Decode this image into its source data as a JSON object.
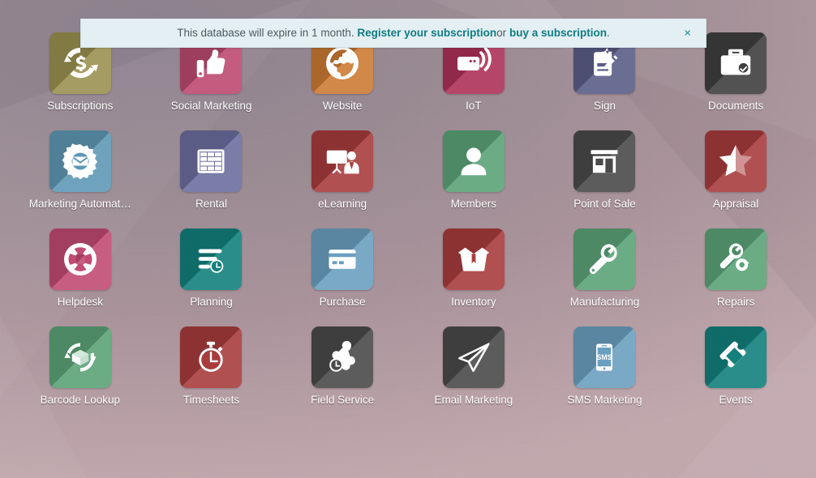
{
  "banner": {
    "text_before": "This database will expire in 1 month.",
    "link_register": "Register your subscription",
    "conjunction": "or",
    "link_buy": "buy a subscription",
    "period": ".",
    "close_label": "×",
    "background_color": "#e3eff3",
    "link_color": "#0f7c82"
  },
  "desktop": {
    "background_color": "#a8939a"
  },
  "apps": [
    {
      "label": "Subscriptions",
      "icon": "subscriptions-icon",
      "color": "#9a9150"
    },
    {
      "label": "Social Marketing",
      "icon": "social-marketing-icon",
      "color": "#bc4a70"
    },
    {
      "label": "Website",
      "icon": "website-icon",
      "color": "#cc7a33"
    },
    {
      "label": "IoT",
      "icon": "iot-icon",
      "color": "#ad3159"
    },
    {
      "label": "Sign",
      "icon": "sign-icon",
      "color": "#5a5e87"
    },
    {
      "label": "Documents",
      "icon": "documents-icon",
      "color": "#3f3f3f"
    },
    {
      "label": "Marketing Automat…",
      "icon": "marketing-automation-icon",
      "color": "#5f98b4"
    },
    {
      "label": "Rental",
      "icon": "rental-icon",
      "color": "#6b6e9e"
    },
    {
      "label": "eLearning",
      "icon": "elearning-icon",
      "color": "#a83c3c"
    },
    {
      "label": "Members",
      "icon": "members-icon",
      "color": "#5aa377"
    },
    {
      "label": "Point of Sale",
      "icon": "point-of-sale-icon",
      "color": "#4a4a4a"
    },
    {
      "label": "Appraisal",
      "icon": "appraisal-icon",
      "color": "#a83c3c"
    },
    {
      "label": "Helpdesk",
      "icon": "helpdesk-icon",
      "color": "#c14b73"
    },
    {
      "label": "Planning",
      "icon": "planning-icon",
      "color": "#12807c"
    },
    {
      "label": "Purchase",
      "icon": "purchase-icon",
      "color": "#6b9fc0"
    },
    {
      "label": "Inventory",
      "icon": "inventory-icon",
      "color": "#a83c3c"
    },
    {
      "label": "Manufacturing",
      "icon": "manufacturing-icon",
      "color": "#5aa377"
    },
    {
      "label": "Repairs",
      "icon": "repairs-icon",
      "color": "#5aa377"
    },
    {
      "label": "Barcode Lookup",
      "icon": "product-cycle-icon",
      "color": "#5aa377"
    },
    {
      "label": "Timesheets",
      "icon": "stopwatch-icon",
      "color": "#a83c3c"
    },
    {
      "label": "Field Service",
      "icon": "field-service-icon",
      "color": "#4a4a4a"
    },
    {
      "label": "Email Marketing",
      "icon": "paper-plane-icon",
      "color": "#4a4a4a"
    },
    {
      "label": "SMS Marketing",
      "icon": "sms-icon",
      "color": "#6b9fc0"
    },
    {
      "label": "Events",
      "icon": "ticket-icon",
      "color": "#12807c"
    }
  ]
}
